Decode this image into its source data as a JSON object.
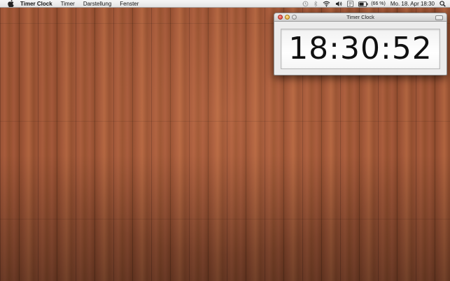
{
  "menubar": {
    "app_name": "Timer Clock",
    "menus": [
      "Timer",
      "Darstellung",
      "Fenster"
    ],
    "battery_percent": "(66 %)",
    "datetime": "Mo. 18. Apr  18:30"
  },
  "icons": {
    "apple": "apple-icon",
    "time_machine": "time-machine-icon",
    "bluetooth": "bluetooth-icon",
    "wifi": "wifi-icon",
    "volume": "volume-icon",
    "input": "input-menu-icon",
    "battery": "battery-icon",
    "spotlight": "search-icon"
  },
  "window": {
    "title": "Timer Clock",
    "time": "18:30:52"
  },
  "colors": {
    "wallpaper": "#9a5235",
    "close": "#d8342a",
    "minimize": "#e3a42a",
    "zoom": "#bcbcbc"
  }
}
